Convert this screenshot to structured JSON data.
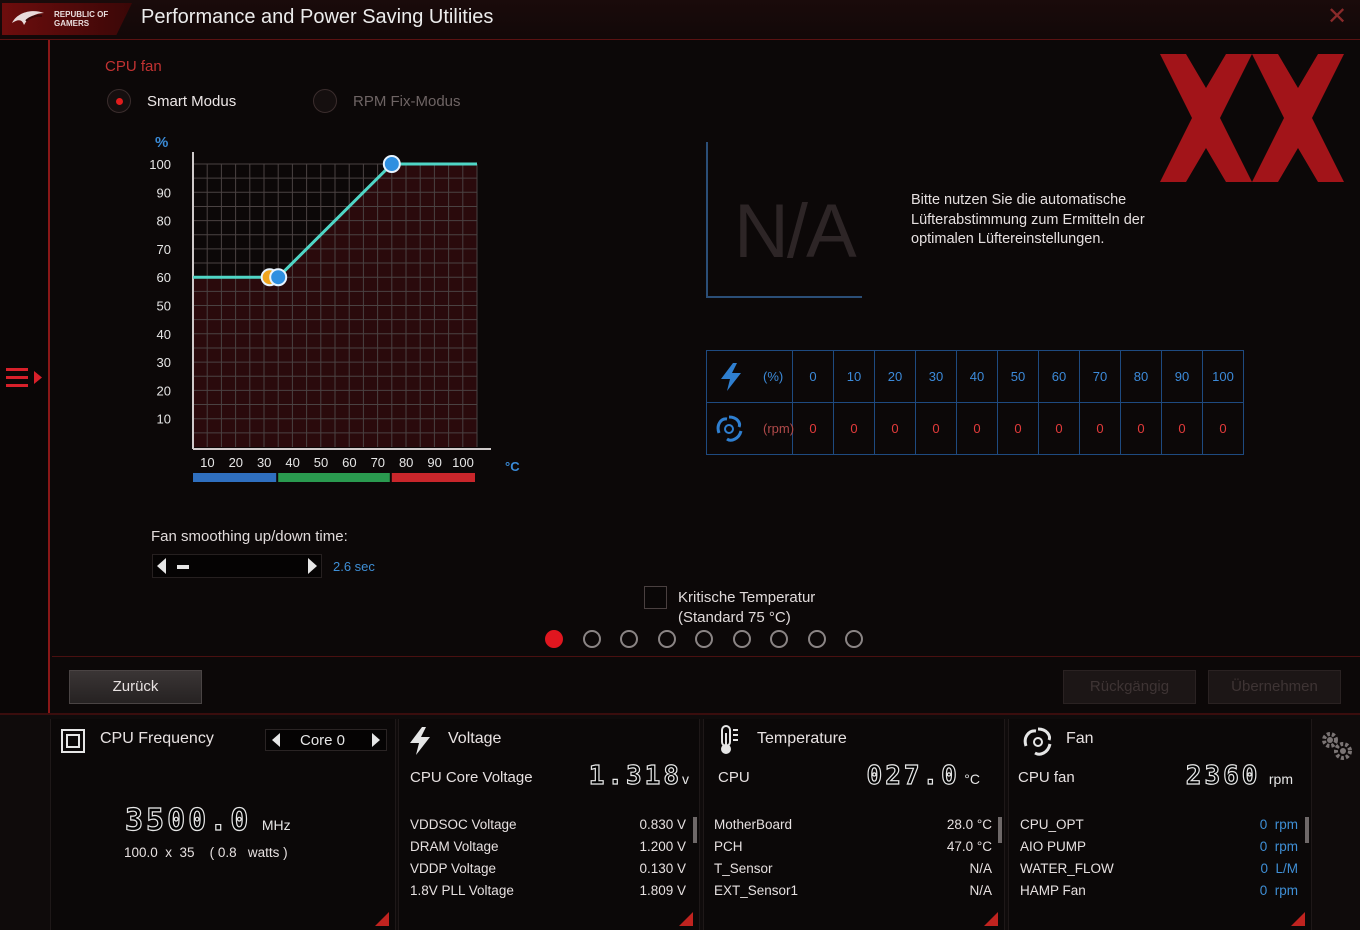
{
  "app": {
    "logo_text": "REPUBLIC OF GAMERS",
    "title": "Performance and Power Saving Utilities",
    "close_glyph": "✕"
  },
  "fan_section": {
    "label": "CPU fan",
    "modes": [
      {
        "label": "Smart Modus",
        "selected": true
      },
      {
        "label": "RPM Fix-Modus",
        "selected": false
      }
    ]
  },
  "chart_data": {
    "type": "line",
    "title": "",
    "xlabel": "°C",
    "ylabel": "%",
    "xlim": [
      0,
      100
    ],
    "ylim": [
      0,
      100
    ],
    "x_ticks": [
      10,
      20,
      30,
      40,
      50,
      60,
      70,
      80,
      90,
      100
    ],
    "y_ticks": [
      10,
      20,
      30,
      40,
      50,
      60,
      70,
      80,
      90,
      100
    ],
    "grid": true,
    "series": [
      {
        "x": [
          0,
          30,
          70,
          100
        ],
        "y": [
          60,
          60,
          100,
          100
        ],
        "color": "#4fd6c6"
      }
    ],
    "control_points": [
      {
        "x": 27,
        "y": 60,
        "color": "#f0a51e"
      },
      {
        "x": 30,
        "y": 60,
        "color": "#2f8fe0"
      },
      {
        "x": 70,
        "y": 100,
        "color": "#2f8fe0"
      }
    ],
    "zones": [
      {
        "from": 0,
        "to": 30,
        "color": "#2f6fbf"
      },
      {
        "from": 30,
        "to": 70,
        "color": "#2a9a4f"
      },
      {
        "from": 70,
        "to": 100,
        "color": "#c9262b"
      }
    ]
  },
  "smoothing": {
    "label": "Fan smoothing up/down time:",
    "value": "2.6 sec"
  },
  "tuning": {
    "na": "N/A",
    "hint": "Bitte nutzen Sie die automatische Lüfterabstimmung zum Ermitteln der optimalen Lüftereinstellungen.",
    "pct_unit": "(%)",
    "rpm_unit": "(rpm)",
    "pct_values": [
      "0",
      "10",
      "20",
      "30",
      "40",
      "50",
      "60",
      "70",
      "80",
      "90",
      "100"
    ],
    "rpm_values": [
      "0",
      "0",
      "0",
      "0",
      "0",
      "0",
      "0",
      "0",
      "0",
      "0",
      "0"
    ]
  },
  "critical": {
    "label_line1": "Kritische Temperatur",
    "label_line2": "(Standard 75 °C)"
  },
  "pager": {
    "count": 9,
    "active": 0
  },
  "actions": {
    "back": "Zurück",
    "undo": "Rückgängig",
    "apply": "Übernehmen"
  },
  "cpu_freq": {
    "title": "CPU Frequency",
    "core": "Core 0",
    "value": "3500.0",
    "unit": "MHz",
    "multiplier": "100.0  x  35",
    "watts": "( 0.8   watts )"
  },
  "voltage": {
    "title": "Voltage",
    "main_label": "CPU Core Voltage",
    "main_value": "1.318",
    "main_unit": "v",
    "rows": [
      {
        "label": "VDDSOC Voltage",
        "value": "0.830  V"
      },
      {
        "label": "DRAM Voltage",
        "value": "1.200  V"
      },
      {
        "label": "VDDP Voltage",
        "value": "0.130  V"
      },
      {
        "label": "1.8V PLL Voltage",
        "value": "1.809  V"
      }
    ]
  },
  "temperature": {
    "title": "Temperature",
    "main_label": "CPU",
    "main_value": "027.0",
    "main_unit": "°C",
    "rows": [
      {
        "label": "MotherBoard",
        "value": "28.0 °C"
      },
      {
        "label": "PCH",
        "value": "47.0 °C"
      },
      {
        "label": "T_Sensor",
        "value": "N/A"
      },
      {
        "label": "EXT_Sensor1",
        "value": "N/A"
      }
    ]
  },
  "fan": {
    "title": "Fan",
    "main_label": "CPU fan",
    "main_value": "2360",
    "main_unit": "rpm",
    "rows": [
      {
        "label": "CPU_OPT",
        "num": "0",
        "unit": "rpm"
      },
      {
        "label": "AIO PUMP",
        "num": "0",
        "unit": "rpm"
      },
      {
        "label": "WATER_FLOW",
        "num": "0",
        "unit": "L/M"
      },
      {
        "label": "HAMP Fan",
        "num": "0",
        "unit": "rpm"
      }
    ]
  },
  "colors": {
    "accent_red": "#e0161f",
    "accent_blue": "#2f8fe0",
    "curve": "#4fd6c6"
  }
}
